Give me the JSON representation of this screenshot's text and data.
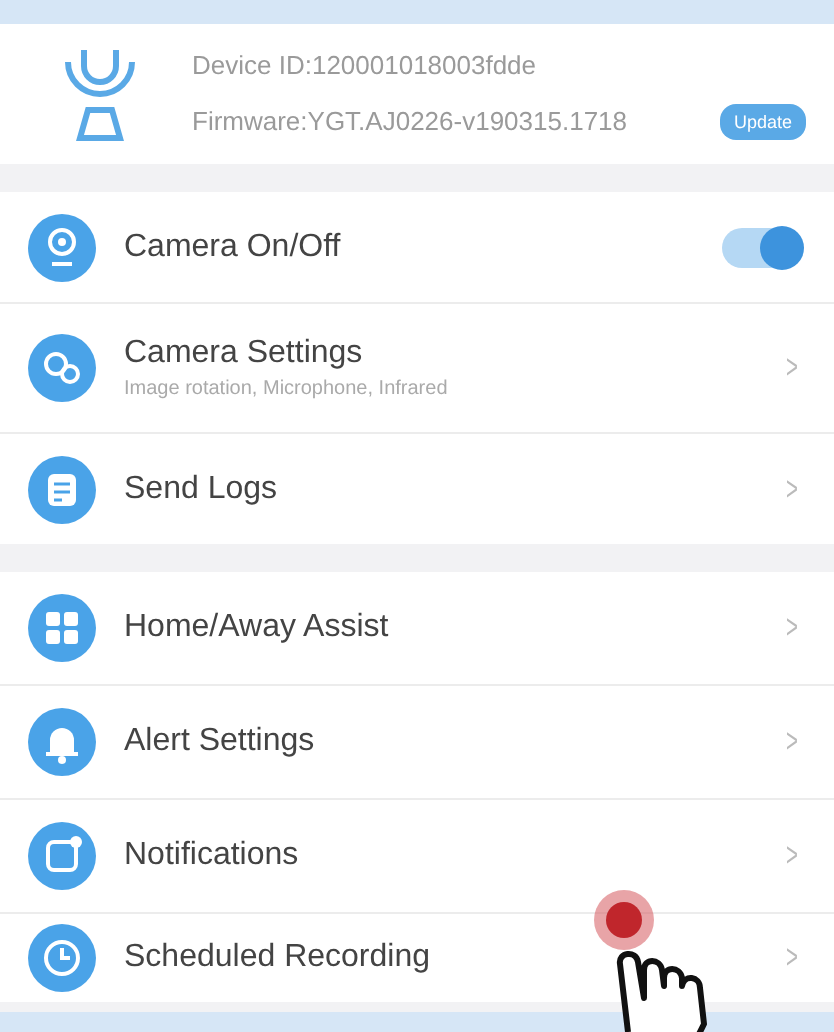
{
  "device": {
    "device_id": "Device ID:120001018003fdde",
    "firmware": "Firmware:YGT.AJ0226-v190315.1718",
    "update_button": "Update"
  },
  "sections": [
    {
      "items": [
        {
          "kind": "toggle",
          "label": "Camera On/Off",
          "on": true
        },
        {
          "kind": "link",
          "label": "Camera Settings",
          "subtitle": "Image rotation, Microphone, Infrared",
          "chevron": ">"
        },
        {
          "kind": "link",
          "label": "Send Logs",
          "chevron": ">"
        }
      ]
    },
    {
      "items": [
        {
          "kind": "link",
          "label": "Home/Away Assist",
          "chevron": ">"
        },
        {
          "kind": "link",
          "label": "Alert Settings",
          "chevron": ">"
        },
        {
          "kind": "link",
          "label": "Notifications",
          "chevron": ">"
        },
        {
          "kind": "link",
          "label": "Scheduled Recording",
          "chevron": ">"
        }
      ]
    }
  ]
}
